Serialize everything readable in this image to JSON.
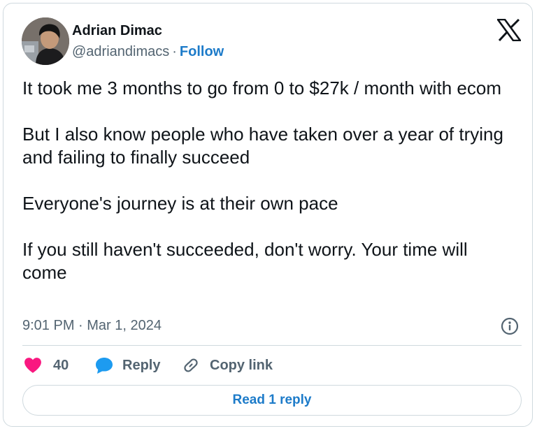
{
  "author": {
    "name": "Adrian Dimac",
    "handle": "@adriandimacs",
    "separator": "·",
    "follow_label": "Follow"
  },
  "tweet": {
    "paragraphs": [
      "It took me 3 months to go from 0 to $27k / month with ecom",
      "But I also know people who have taken over a year of trying and failing to finally succeed",
      "Everyone's journey is at their own pace",
      "If you still haven't succeeded, don't worry. Your time will come"
    ],
    "timestamp": "9:01 PM · Mar 1, 2024"
  },
  "actions": {
    "like_count": "40",
    "reply_label": "Reply",
    "copy_link_label": "Copy link"
  },
  "read_replies_label": "Read 1 reply",
  "icons": {
    "brand": "x-logo-icon",
    "info": "info-icon",
    "like": "heart-icon",
    "reply": "speech-bubble-icon",
    "copy": "link-icon"
  },
  "colors": {
    "like": "#f91880",
    "reply": "#1d9bf0",
    "link_text": "#1d7bc9",
    "secondary_text": "#536471",
    "border": "#cfd9de"
  }
}
